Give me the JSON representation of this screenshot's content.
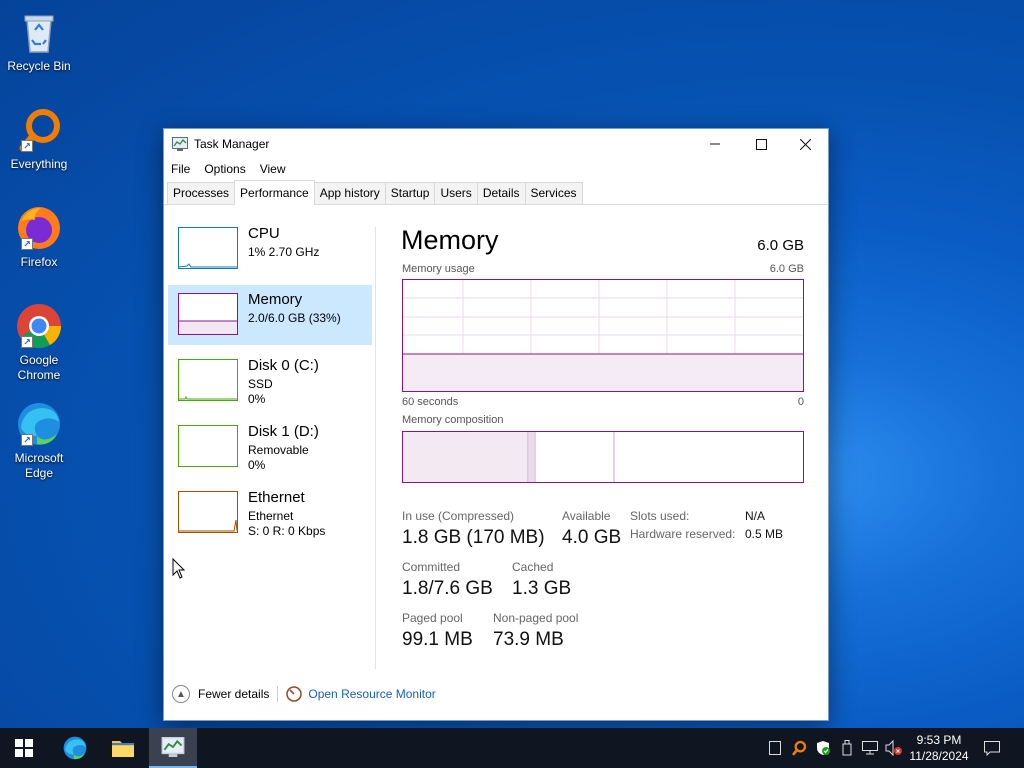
{
  "desktop": {
    "icons": [
      {
        "label": "Recycle Bin"
      },
      {
        "label": "Everything"
      },
      {
        "label": "Firefox"
      },
      {
        "label": "Google Chrome"
      },
      {
        "label": "Microsoft Edge"
      }
    ]
  },
  "window": {
    "title": "Task Manager",
    "menu": [
      "File",
      "Options",
      "View"
    ],
    "tabs": [
      "Processes",
      "Performance",
      "App history",
      "Startup",
      "Users",
      "Details",
      "Services"
    ],
    "active_tab": "Performance"
  },
  "perf_list": [
    {
      "title": "CPU",
      "sub1": "1% 2.70 GHz",
      "color": "#117dbb"
    },
    {
      "title": "Memory",
      "sub1": "2.0/6.0 GB (33%)",
      "color": "#8b128b",
      "selected": true
    },
    {
      "title": "Disk 0 (C:)",
      "sub1": "SSD",
      "sub2": "0%",
      "color": "#4da60c"
    },
    {
      "title": "Disk 1 (D:)",
      "sub1": "Removable",
      "sub2": "0%",
      "color": "#4da60c"
    },
    {
      "title": "Ethernet",
      "sub1": "Ethernet",
      "sub2": "S: 0 R: 0 Kbps",
      "color": "#a74f01"
    }
  ],
  "memory": {
    "title": "Memory",
    "total": "6.0 GB",
    "usage_label": "Memory usage",
    "usage_max": "6.0 GB",
    "time_left": "60 seconds",
    "time_right": "0",
    "usage_fraction": 0.33,
    "composition_label": "Memory composition",
    "in_use_label": "In use (Compressed)",
    "in_use_value": "1.8 GB (170 MB)",
    "available_label": "Available",
    "available_value": "4.0 GB",
    "committed_label": "Committed",
    "committed_value": "1.8/7.6 GB",
    "cached_label": "Cached",
    "cached_value": "1.3 GB",
    "paged_label": "Paged pool",
    "paged_value": "99.1 MB",
    "nonpaged_label": "Non-paged pool",
    "nonpaged_value": "73.9 MB",
    "slots_label": "Slots used:",
    "slots_value": "N/A",
    "hw_label": "Hardware reserved:",
    "hw_value": "0.5 MB"
  },
  "footer": {
    "fewer_details": "Fewer details",
    "open_monitor": "Open Resource Monitor"
  },
  "clock": {
    "time": "9:53 PM",
    "date": "11/28/2024"
  },
  "colors": {
    "memory_accent": "#8b128b",
    "selected_bg": "#cce8ff",
    "taskbar": "#101522"
  }
}
